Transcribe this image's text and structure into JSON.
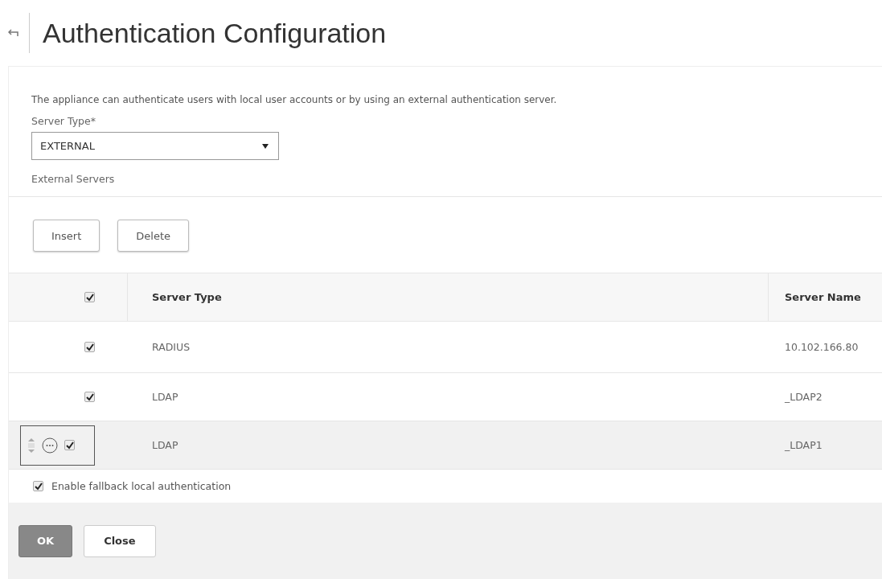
{
  "header": {
    "title": "Authentication Configuration"
  },
  "form": {
    "description": "The appliance can authenticate users with local user accounts or by using an external authentication server.",
    "server_type": {
      "label": "Server Type*",
      "value": "EXTERNAL"
    },
    "section_label": "External Servers"
  },
  "toolbar": [
    "Insert",
    "Delete"
  ],
  "table": {
    "select_all": {
      "checked": true
    },
    "columns": [
      "Server Type",
      "Server Name"
    ],
    "rows": [
      {
        "cells": [
          "RADIUS",
          "10.102.166.80"
        ],
        "checked": true,
        "hovered": false
      },
      {
        "cells": [
          "LDAP",
          "_LDAP2"
        ],
        "checked": true,
        "hovered": false
      },
      {
        "cells": [
          "LDAP",
          "_LDAP1"
        ],
        "checked": true,
        "hovered": true
      }
    ]
  },
  "fallback": {
    "label": "Enable fallback local authentication",
    "checked": true
  },
  "footer": [
    {
      "label": "OK",
      "kind": "primary"
    },
    {
      "label": "Close",
      "kind": "secondary"
    }
  ]
}
